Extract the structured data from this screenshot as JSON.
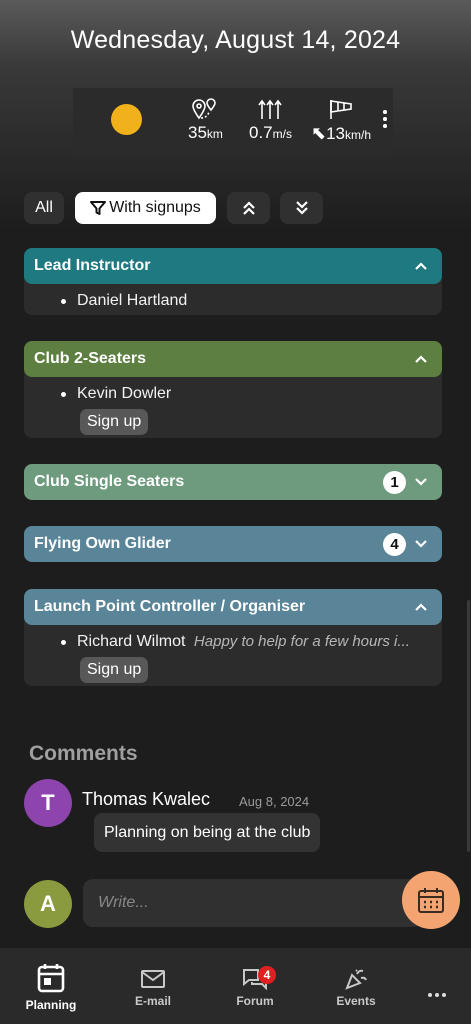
{
  "header": {
    "date": "Wednesday, August 14, 2024"
  },
  "weather": {
    "icon": "sun-icon",
    "sun_color": "#f0b11b",
    "distance": {
      "value": "35",
      "unit": "km"
    },
    "climb": {
      "value": "0.7",
      "unit": "m/s"
    },
    "wind": {
      "value": "13",
      "unit": "km/h"
    }
  },
  "filters": {
    "all_label": "All",
    "with_signups_label": "With signups"
  },
  "duties": [
    {
      "title": "Lead Instructor",
      "color": "#1e7a80",
      "expanded": true,
      "people": [
        {
          "name": "Daniel Hartland",
          "note": ""
        }
      ],
      "signup": ""
    },
    {
      "title": "Club 2-Seaters",
      "color": "#5d7f42",
      "expanded": true,
      "people": [
        {
          "name": "Kevin Dowler",
          "note": ""
        }
      ],
      "signup": "Sign up"
    },
    {
      "title": "Club Single Seaters",
      "color": "#6e9a7e",
      "expanded": false,
      "count": "1"
    },
    {
      "title": "Flying Own Glider",
      "color": "#5a8497",
      "expanded": false,
      "count": "4"
    },
    {
      "title": "Launch Point Controller / Organiser",
      "color": "#5a8497",
      "expanded": true,
      "people": [
        {
          "name": "Richard Wilmot",
          "note": "Happy to help for a few hours i..."
        }
      ],
      "signup": "Sign up"
    }
  ],
  "comments": {
    "heading": "Comments",
    "items": [
      {
        "initial": "T",
        "avatar_color": "#8e44ad",
        "author": "Thomas Kwalec",
        "date": "Aug 8, 2024",
        "text": "Planning on being at the club"
      }
    ],
    "composer": {
      "initial": "A",
      "avatar_color": "#8a9a3e",
      "placeholder": "Write..."
    }
  },
  "nav": {
    "items": [
      {
        "label": "Planning",
        "icon": "calendar-icon",
        "active": true
      },
      {
        "label": "E-mail",
        "icon": "mail-icon"
      },
      {
        "label": "Forum",
        "icon": "forum-icon",
        "badge": "4"
      },
      {
        "label": "Events",
        "icon": "party-icon"
      }
    ],
    "more_icon": "more-horizontal-icon"
  }
}
